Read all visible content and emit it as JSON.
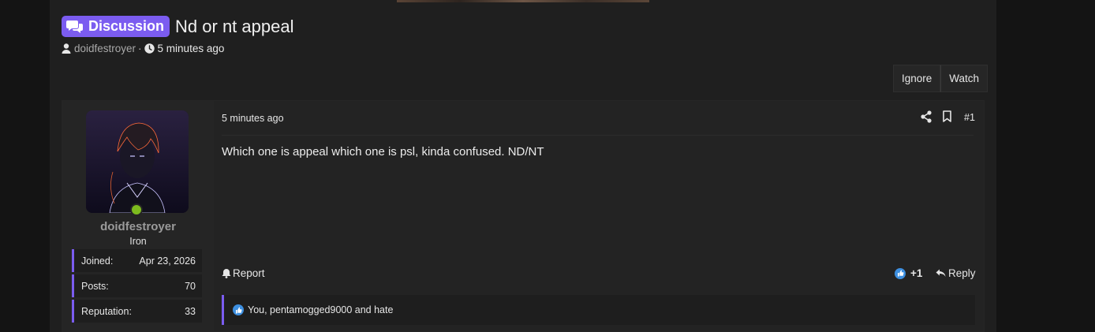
{
  "thread": {
    "prefix": "Discussion",
    "title": "Nd or nt appeal",
    "author": "doidfestroyer",
    "separator": "·",
    "time": "5 minutes ago"
  },
  "toolbar": {
    "ignore_label": "Ignore",
    "watch_label": "Watch"
  },
  "user": {
    "name": "doidfestroyer",
    "rank": "Iron",
    "stats": [
      {
        "label": "Joined:",
        "value": "Apr 23, 2026"
      },
      {
        "label": "Posts:",
        "value": "70"
      },
      {
        "label": "Reputation:",
        "value": "33"
      }
    ]
  },
  "post": {
    "time": "5 minutes ago",
    "number": "#1",
    "body": "Which one is appeal which one is psl, kinda confused. ND/NT",
    "report_label": "Report",
    "like_count": "+1",
    "reply_label": "Reply",
    "reactions_text": "You, pentamogged9000 and hate"
  },
  "colors": {
    "accent": "#7b5cf0",
    "online": "#7dbb1e",
    "like": "#3d8fe0"
  }
}
